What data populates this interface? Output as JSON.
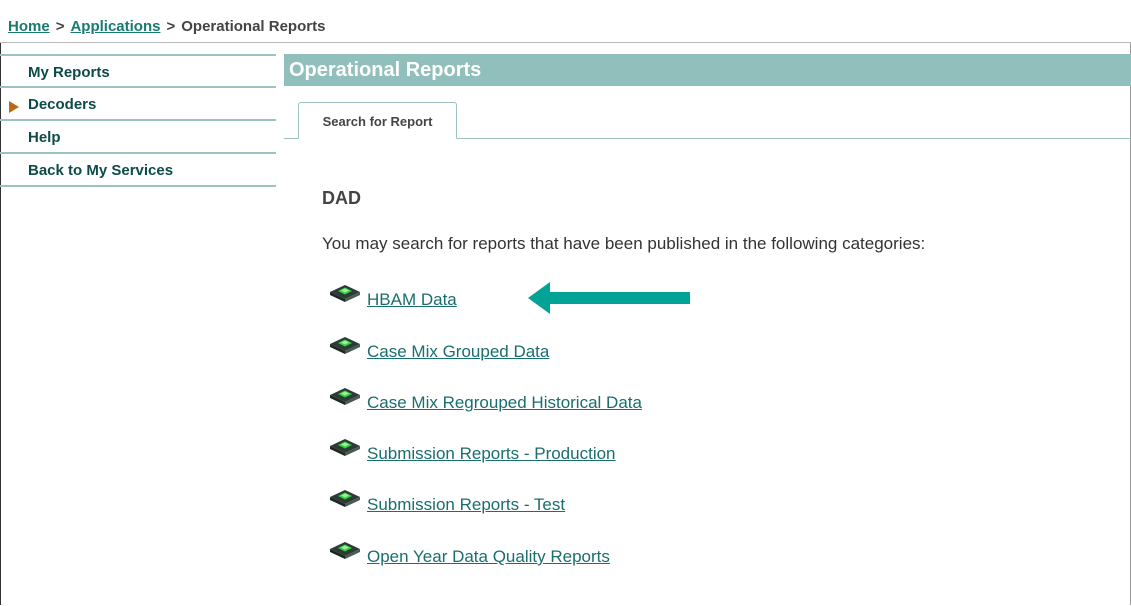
{
  "breadcrumb": {
    "home": "Home",
    "applications": "Applications",
    "current": "Operational Reports",
    "separator": ">"
  },
  "sidebar": {
    "items": [
      {
        "label": "My Reports"
      },
      {
        "label": "Decoders"
      },
      {
        "label": "Help"
      },
      {
        "label": "Back to My Services"
      }
    ]
  },
  "header": {
    "title": "Operational Reports"
  },
  "tabs": [
    {
      "label": "Search for Report"
    }
  ],
  "main": {
    "heading": "DAD",
    "intro": "You may search for reports that have been published in the following categories:",
    "reports": [
      {
        "label": "HBAM Data"
      },
      {
        "label": "Case Mix Grouped Data"
      },
      {
        "label": "Case Mix Regrouped Historical Data"
      },
      {
        "label": "Submission Reports - Production"
      },
      {
        "label": "Submission Reports - Test"
      },
      {
        "label": "Open Year Data Quality Reports"
      }
    ]
  },
  "colors": {
    "accent_teal": "#91bfbb",
    "link": "#1a6e6e",
    "annotation_arrow": "#00a396",
    "bullet_arrow": "#b86a18"
  },
  "icons": {
    "report_item": "report-gem-icon",
    "decoders_marker": "triangle-right-icon",
    "annotation": "arrow-left-icon"
  }
}
